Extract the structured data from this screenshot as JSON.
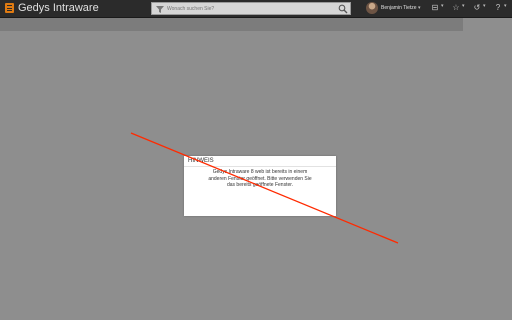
{
  "header": {
    "app_title": "Gedys Intraware",
    "search_placeholder": "Wonach suchen Sie?",
    "user_name": "Benjamin Tietze",
    "menu_icon": "hamburger-menu-icon",
    "accent": "#e07b12"
  },
  "dialog": {
    "title": "HINWEIS",
    "message": "Gedys Intraware 8 web ist bereits in einem anderen Fenster geöffnet. Bitte verwenden Sie das bereits geöffnete Fenster."
  },
  "annotation": {
    "color": "#ff2a00"
  }
}
